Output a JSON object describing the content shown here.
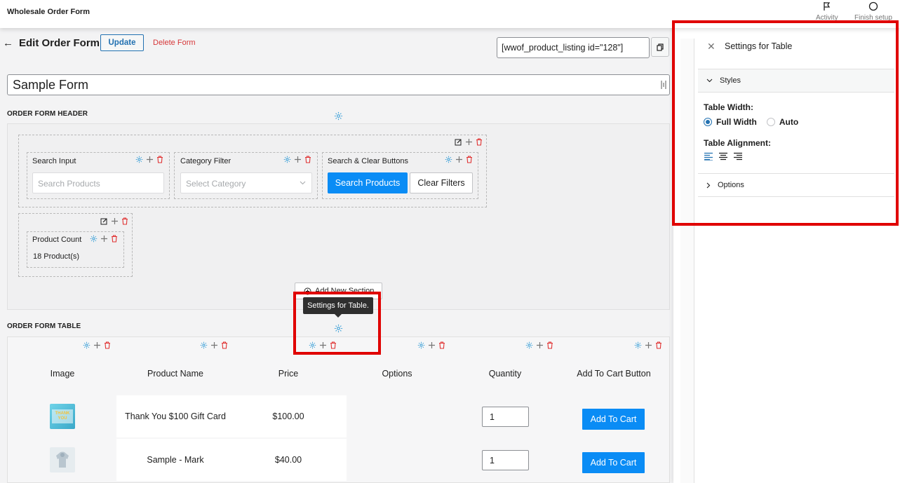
{
  "topbar": {
    "app_title": "Wholesale Order Form",
    "activity_label": "Activity",
    "finish_setup_label": "Finish setup"
  },
  "header": {
    "back_icon": "arrow-left-icon",
    "title": "Edit Order Form",
    "update_label": "Update",
    "delete_label": "Delete Form",
    "shortcode": "[wwof_product_listing id=\"128\"]"
  },
  "form": {
    "name_value": "Sample Form"
  },
  "order_form_header": {
    "label": "ORDER FORM HEADER",
    "search_input": {
      "label": "Search Input",
      "placeholder": "Search Products"
    },
    "category_filter": {
      "label": "Category Filter",
      "placeholder": "Select Category"
    },
    "search_clear": {
      "label": "Search & Clear Buttons",
      "search_label": "Search Products",
      "clear_label": "Clear Filters"
    },
    "product_count": {
      "label": "Product Count",
      "value": "18 Product(s)"
    },
    "add_section_label": "Add New Section"
  },
  "tooltip": "Settings for Table.",
  "order_form_table": {
    "label": "ORDER FORM TABLE",
    "columns": [
      "Image",
      "Product Name",
      "Price",
      "Options",
      "Quantity",
      "Add To Cart Button"
    ],
    "rows": [
      {
        "name": "Thank You $100 Gift Card",
        "price": "$100.00",
        "quantity": "1",
        "button": "Add To Cart",
        "thumb_text": "THANK YOU"
      },
      {
        "name": "Sample - Mark",
        "price": "$40.00",
        "quantity": "1",
        "button": "Add To Cart"
      }
    ]
  },
  "settings_panel": {
    "title": "Settings for Table",
    "styles_label": "Styles",
    "table_width_label": "Table Width:",
    "width_options": [
      "Full Width",
      "Auto"
    ],
    "selected_width": "Full Width",
    "table_alignment_label": "Table Alignment:",
    "alignment_icons": [
      "align-left-icon",
      "align-center-icon",
      "align-right-icon"
    ],
    "selected_alignment": "align-left-icon",
    "options_label": "Options"
  },
  "colors": {
    "primary_button": "#0a8cf5",
    "highlight_border": "#e00000",
    "delete_red": "#d63638",
    "gear_blue": "#3ba0d8"
  }
}
